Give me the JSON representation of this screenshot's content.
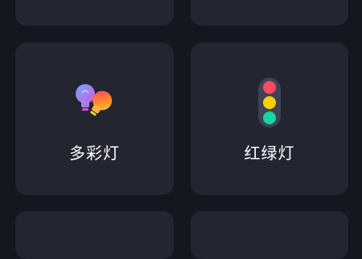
{
  "tiles": [
    {
      "label": "多彩灯",
      "icon": "multicolor-bulb-icon",
      "colors": {
        "bulb_left_top": "#6ea8ff",
        "bulb_left_bottom": "#d55ad8",
        "bulb_right_top": "#ff3d6b",
        "bulb_right_mid": "#ff8c2a",
        "bulb_right_bottom": "#ffd23a"
      }
    },
    {
      "label": "红绿灯",
      "icon": "traffic-light-icon",
      "colors": {
        "housing": "#3d4257",
        "red": "#ff4a5d",
        "yellow": "#ffd000",
        "green": "#18d6a3"
      }
    }
  ],
  "theme": {
    "background": "#15161e",
    "card": "#232530",
    "text": "#ffffff"
  }
}
